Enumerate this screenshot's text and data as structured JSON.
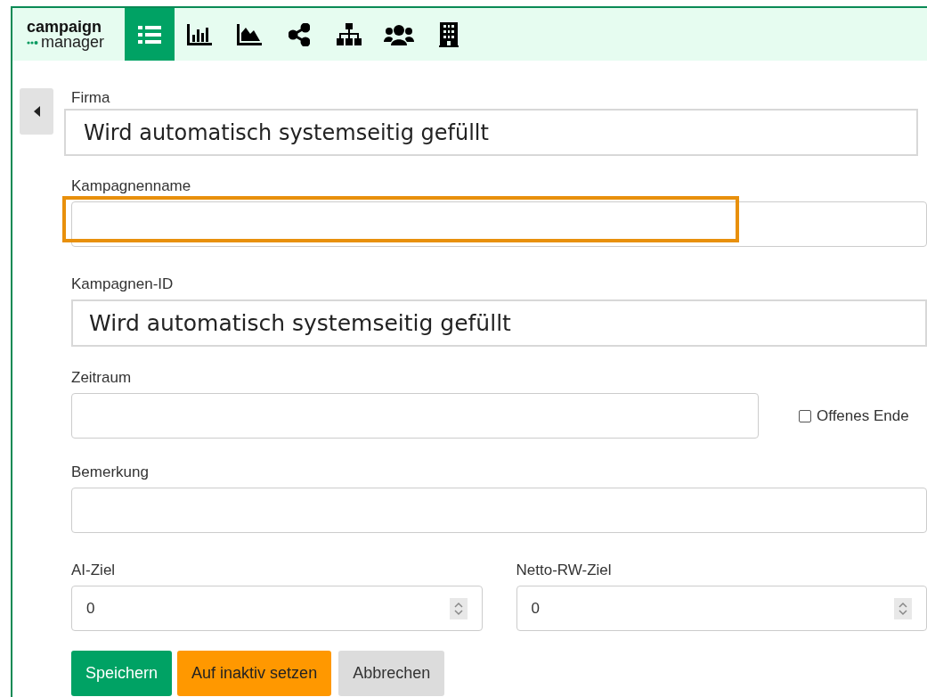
{
  "logo": {
    "line_1": "campaign",
    "line_2": "manager"
  },
  "nav": [
    {
      "kind": "list",
      "selected": true
    },
    {
      "kind": "bars",
      "selected": false
    },
    {
      "kind": "area",
      "selected": false
    },
    {
      "kind": "share",
      "selected": false
    },
    {
      "kind": "tree",
      "selected": false
    },
    {
      "kind": "users",
      "selected": false
    },
    {
      "kind": "building",
      "selected": false
    }
  ],
  "form": [
    {
      "kind": "note",
      "label": "Firma",
      "value": "Wird automatisch systemseitig gefüllt"
    },
    {
      "kind": "text",
      "label": "Kampagnenname",
      "highlighted": true
    },
    {
      "kind": "note",
      "label": "Kampagnen-ID",
      "value": "Wird automatisch systemseitig gefüllt"
    },
    {
      "kind": "period",
      "label": "Zeitraum",
      "checkbox": {
        "label": "Offenes Ende",
        "checked": false
      }
    },
    {
      "kind": "text",
      "label": "Bemerkung",
      "highlighted": false
    },
    {
      "kind": "numbers",
      "items": [
        {
          "label": "AI-Ziel",
          "value": "0"
        },
        {
          "label": "Netto-RW-Ziel",
          "value": "0"
        }
      ]
    }
  ],
  "buttons": [
    {
      "label": "Speichern",
      "kind": "primary"
    },
    {
      "label": "Auf inaktiv setzen",
      "kind": "warning"
    },
    {
      "label": "Abbrechen",
      "kind": "secondary"
    }
  ]
}
